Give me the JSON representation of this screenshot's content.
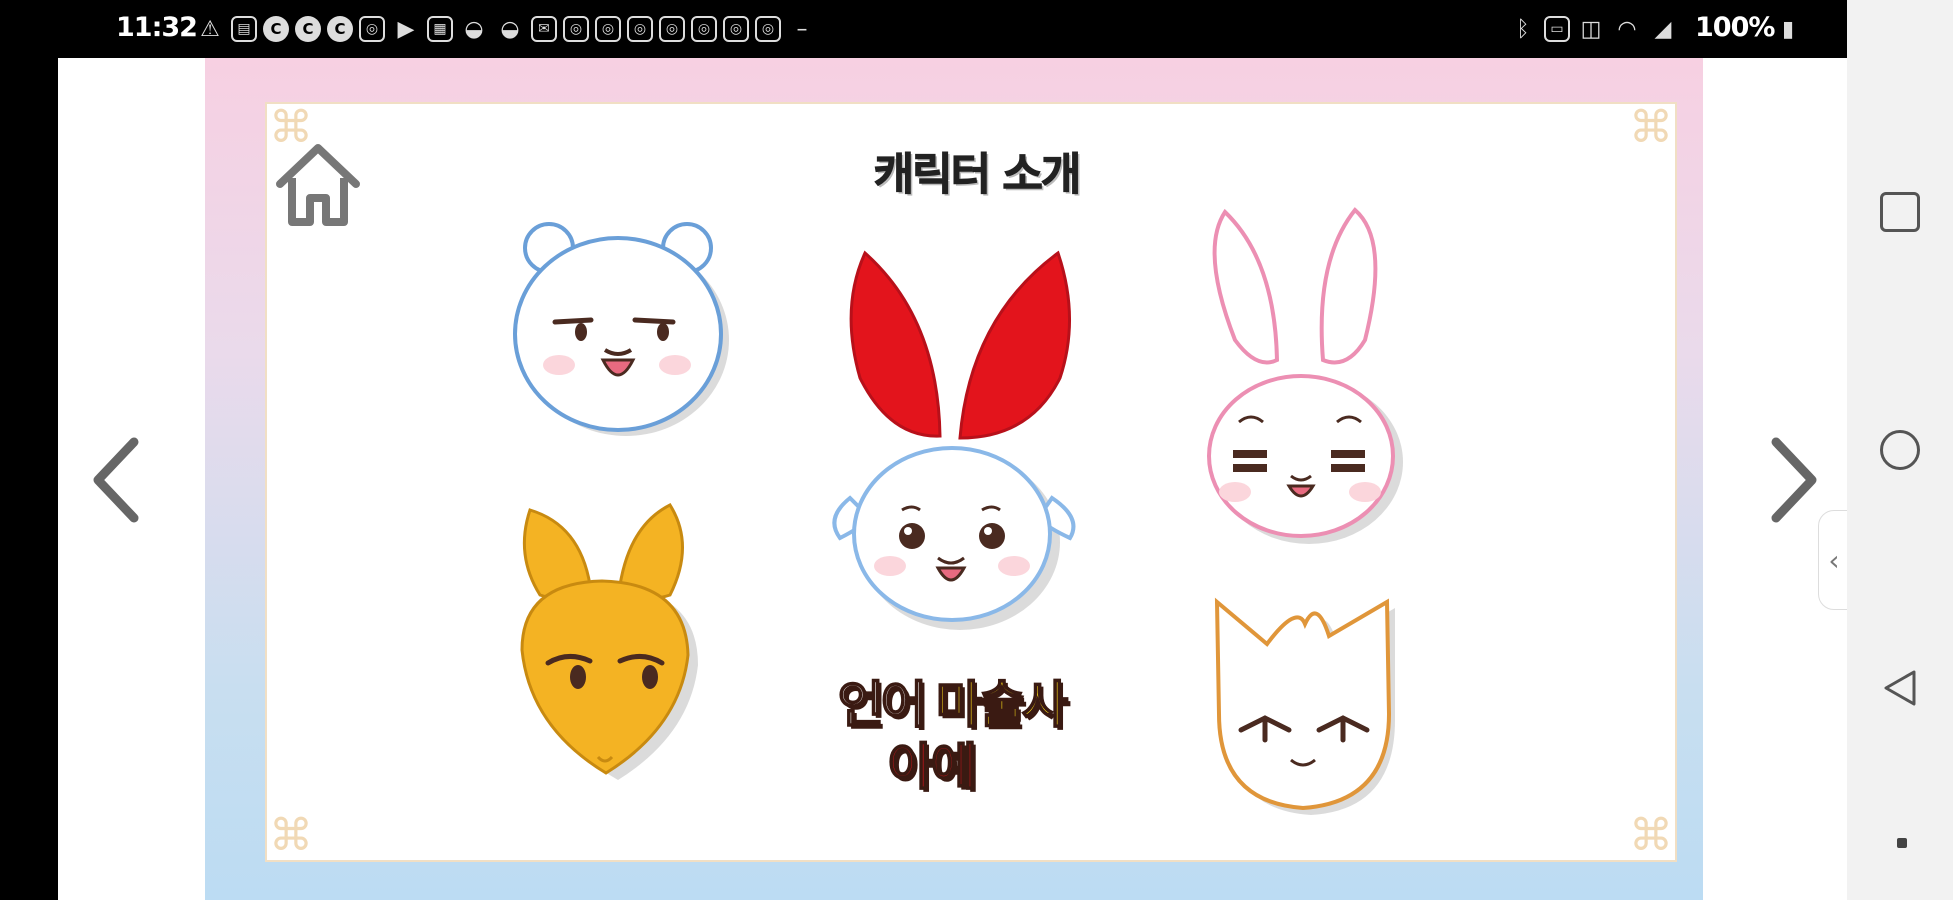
{
  "status_bar": {
    "time": "11:32",
    "battery": "100%",
    "left_icons": [
      "warning-icon",
      "notes-icon",
      "c-icon",
      "c-icon",
      "c-icon",
      "instagram-icon",
      "youtube-icon",
      "gallery-icon",
      "bowl-icon",
      "bowl-icon",
      "mail-icon",
      "instagram-icon",
      "instagram-icon",
      "instagram-icon",
      "instagram-icon",
      "instagram-icon",
      "instagram-icon",
      "instagram-icon",
      "dash-icon"
    ],
    "right_icons": [
      "bluetooth-icon",
      "nfc-icon",
      "vibrate-icon",
      "wifi-icon",
      "signal-icon",
      "battery-icon"
    ]
  },
  "page": {
    "title": "캐릭터 소개"
  },
  "navigation": {
    "prev_icon": "chevron-left-icon",
    "next_icon": "chevron-right-icon",
    "home_icon": "home-icon",
    "side_handle_glyph": "‹"
  },
  "characters": [
    {
      "id": "bear",
      "icon": "bear-face-icon",
      "outline": "#6a9fd8"
    },
    {
      "id": "rabbit-red",
      "icon": "red-ear-rabbit-icon",
      "outline": "#8ab8e8",
      "ear_color": "#e3141c"
    },
    {
      "id": "rabbit-pink",
      "icon": "pink-rabbit-icon",
      "outline": "#ec8fb3"
    },
    {
      "id": "rabbit-orange",
      "icon": "orange-rabbit-icon",
      "fill": "#f4b323"
    },
    {
      "id": "cat",
      "icon": "cat-face-icon",
      "outline": "#e0963a"
    }
  ],
  "logo": {
    "line1_a": "언어",
    "line1_b": "마술사",
    "line2": "아예",
    "colors": {
      "a": "#ffffff",
      "b": "#ffe01a",
      "c": "#e3141c",
      "outline": "#3a1a12"
    }
  },
  "android_nav": {
    "buttons": [
      "recents-icon",
      "home-circle-icon",
      "back-triangle-icon"
    ]
  },
  "colors": {
    "frame_top": "#f7d0e2",
    "frame_bottom": "#bcdcf3",
    "paper_border": "#f1dfc4"
  }
}
